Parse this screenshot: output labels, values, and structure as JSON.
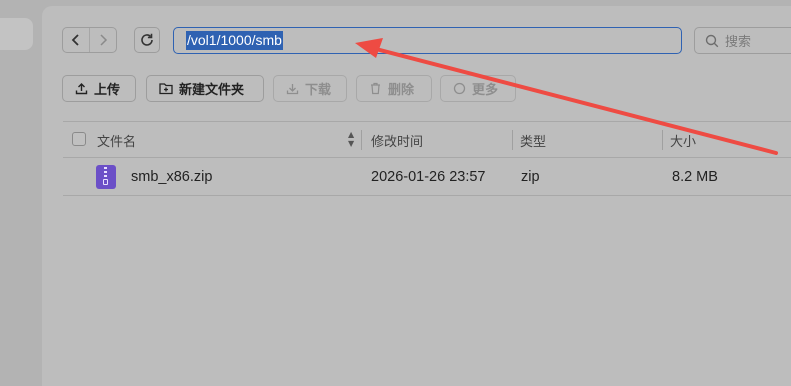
{
  "nav": {
    "back_label": "‹",
    "forward_label": "›"
  },
  "path": {
    "value": "/vol1/1000/smb"
  },
  "search": {
    "placeholder": "搜索"
  },
  "toolbar": {
    "upload": "上传",
    "new_folder": "新建文件夹",
    "download": "下载",
    "delete": "删除",
    "more": "更多"
  },
  "table": {
    "columns": {
      "name": "文件名",
      "modified": "修改时间",
      "type": "类型",
      "size": "大小"
    },
    "rows": [
      {
        "name": "smb_x86.zip",
        "modified": "2026-01-26 23:57",
        "type": "zip",
        "size": "8.2 MB"
      }
    ]
  },
  "icons": [
    "chevron-left-icon",
    "chevron-right-icon",
    "refresh-icon",
    "search-icon",
    "upload-icon",
    "new-folder-icon",
    "download-icon",
    "delete-icon",
    "more-icon",
    "zip-file-icon"
  ],
  "colors": {
    "selection": "#2f62b2",
    "annotation_arrow": "#ee4b43",
    "zip_icon": "#6b4fc7"
  }
}
